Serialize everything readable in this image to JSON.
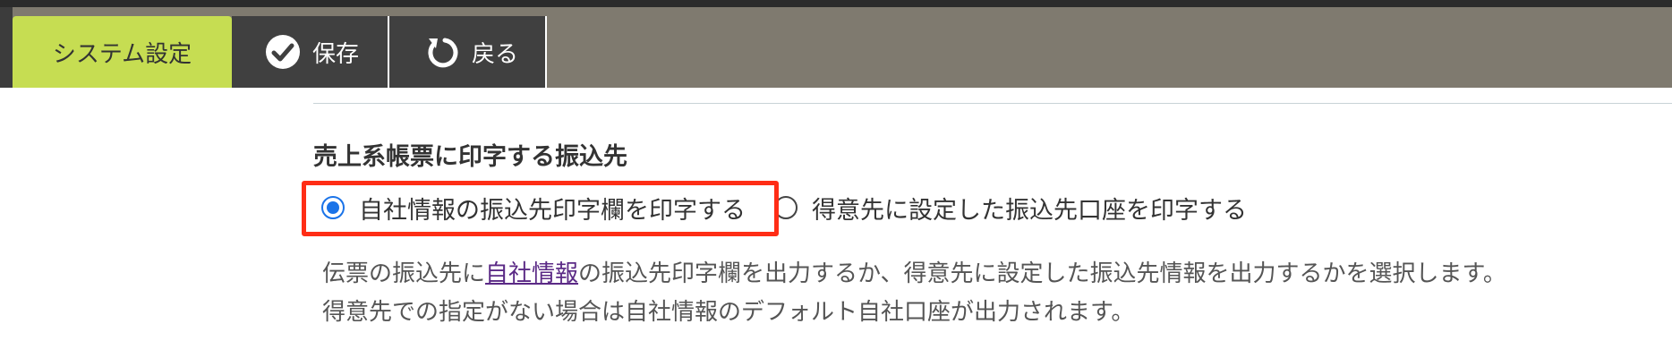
{
  "toolbar": {
    "tab_label": "システム設定",
    "save_label": "保存",
    "back_label": "戻る",
    "save_icon": "check-circle-icon",
    "back_icon": "rotate-back-icon"
  },
  "section": {
    "title": "売上系帳票に印字する振込先",
    "options": [
      {
        "label": "自社情報の振込先印字欄を印字する",
        "checked": true
      },
      {
        "label": "得意先に設定した振込先口座を印字する",
        "checked": false
      }
    ],
    "description": {
      "line1_prefix": "伝票の振込先に",
      "line1_link": "自社情報",
      "line1_suffix": "の振込先印字欄を出力するか、得意先に設定した振込先情報を出力するかを選択します。",
      "line2": "得意先での指定がない場合は自社情報のデフォルト自社口座が出力されます。"
    }
  },
  "colors": {
    "active_tab": "#c6dd52",
    "toolbar_bg": "#7f7a6f",
    "button_bg": "#404040",
    "highlight": "#ff2d16",
    "radio_accent": "#1a73e8",
    "link": "#5b2a86"
  }
}
